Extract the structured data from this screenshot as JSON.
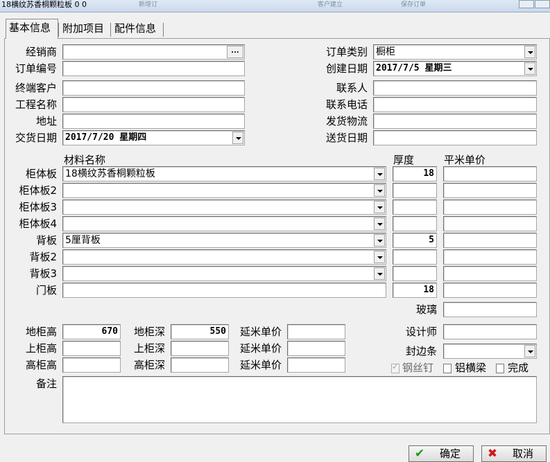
{
  "window": {
    "title": "18横纹苏香桐颗粒板 0 0",
    "ghost_items": [
      "新增订",
      "客户建立",
      "保存订单"
    ]
  },
  "tabs": [
    {
      "label": "基本信息",
      "active": true
    },
    {
      "label": "附加项目",
      "active": false
    },
    {
      "label": "配件信息",
      "active": false
    }
  ],
  "left_fields": {
    "dealer": {
      "label": "经销商",
      "value": "",
      "button": "..."
    },
    "order_no": {
      "label": "订单编号",
      "value": ""
    },
    "end_customer": {
      "label": "终端客户",
      "value": ""
    },
    "project": {
      "label": "工程名称",
      "value": ""
    },
    "address": {
      "label": "地址",
      "value": ""
    },
    "delivery_date": {
      "label": "交货日期",
      "value": "2017/7/20  星期四"
    }
  },
  "right_fields": {
    "order_type": {
      "label": "订单类别",
      "value": "橱柜"
    },
    "created_date": {
      "label": "创建日期",
      "value": "2017/7/5  星期三"
    },
    "contact": {
      "label": "联系人",
      "value": ""
    },
    "phone": {
      "label": "联系电话",
      "value": ""
    },
    "logistics": {
      "label": "发货物流",
      "value": ""
    },
    "ship_date": {
      "label": "送货日期",
      "value": ""
    }
  },
  "materials": {
    "headers": {
      "name": "材料名称",
      "thickness": "厚度",
      "unit_price": "平米单价"
    },
    "rows": [
      {
        "label": "柜体板",
        "name": "18横纹苏香桐颗粒板",
        "thickness": "18",
        "unit_price": ""
      },
      {
        "label": "柜体板2",
        "name": "",
        "thickness": "",
        "unit_price": ""
      },
      {
        "label": "柜体板3",
        "name": "",
        "thickness": "",
        "unit_price": ""
      },
      {
        "label": "柜体板4",
        "name": "",
        "thickness": "",
        "unit_price": ""
      },
      {
        "label": "背板",
        "name": "5厘背板",
        "thickness": "5",
        "unit_price": ""
      },
      {
        "label": "背板2",
        "name": "",
        "thickness": "",
        "unit_price": ""
      },
      {
        "label": "背板3",
        "name": "",
        "thickness": "",
        "unit_price": ""
      },
      {
        "label": "门板",
        "name": "",
        "thickness": "18",
        "unit_price": ""
      }
    ],
    "glass": {
      "label": "玻璃",
      "value": ""
    }
  },
  "cabinets": [
    {
      "h_label": "地柜高",
      "h_value": "670",
      "d_label": "地柜深",
      "d_value": "550",
      "p_label": "延米单价",
      "p_value": ""
    },
    {
      "h_label": "上柜高",
      "h_value": "",
      "d_label": "上柜深",
      "d_value": "",
      "p_label": "延米单价",
      "p_value": ""
    },
    {
      "h_label": "高柜高",
      "h_value": "",
      "d_label": "高柜深",
      "d_value": "",
      "p_label": "延米单价",
      "p_value": ""
    }
  ],
  "designer": {
    "label": "设计师",
    "value": ""
  },
  "edge_band": {
    "label": "封边条",
    "value": ""
  },
  "checkboxes": [
    {
      "label": "钢丝钉",
      "checked": true
    },
    {
      "label": "铝横梁",
      "checked": false
    },
    {
      "label": "完成",
      "checked": false
    }
  ],
  "remarks": {
    "label": "备注",
    "value": ""
  },
  "buttons": {
    "ok": "确定",
    "cancel": "取消"
  },
  "colors": {
    "ok_icon": "#1a9a1a",
    "cancel_icon": "#d01818"
  }
}
